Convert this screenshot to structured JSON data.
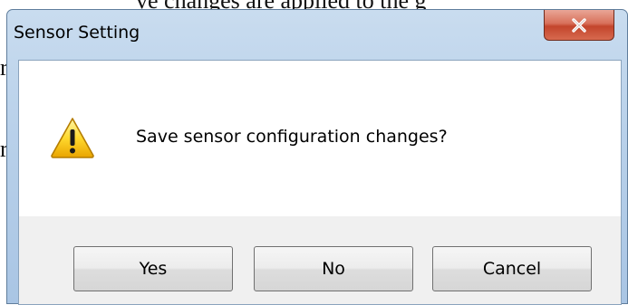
{
  "dialog": {
    "title": "Sensor Setting",
    "message": "Save sensor configuration changes?",
    "icon": "warning-icon",
    "buttons": {
      "yes": "Yes",
      "no": "No",
      "cancel": "Cancel"
    }
  },
  "background_text": {
    "top_line": "ve changes are applied to the g",
    "frag1": "r",
    "frag2": "r"
  },
  "colors": {
    "close_button": "#c3452c",
    "titlebar": "#b9d1ea",
    "button_bar": "#f0f0f0"
  }
}
